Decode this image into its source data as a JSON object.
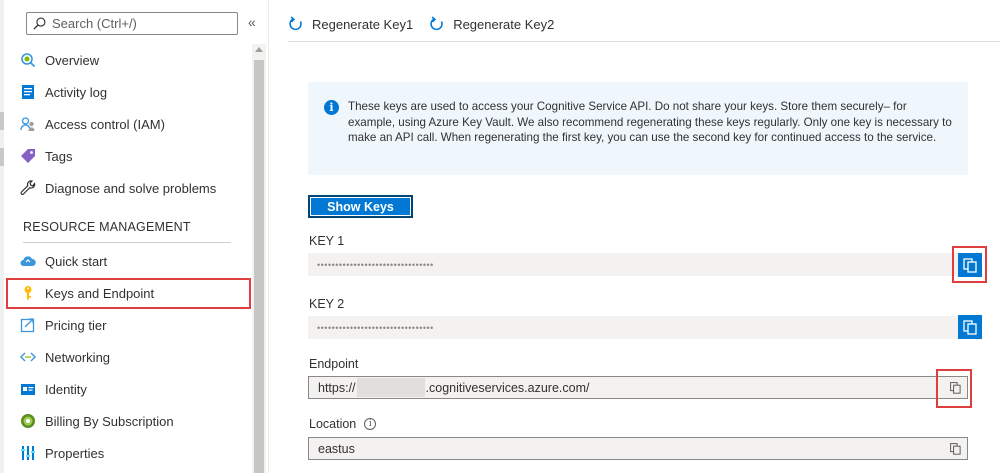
{
  "sidebar": {
    "search_placeholder": "Search (Ctrl+/)",
    "collapse_glyph": "«",
    "items": [
      {
        "label": "Overview",
        "icon": "overview-icon"
      },
      {
        "label": "Activity log",
        "icon": "activity-log-icon"
      },
      {
        "label": "Access control (IAM)",
        "icon": "access-control-icon"
      },
      {
        "label": "Tags",
        "icon": "tag-icon"
      },
      {
        "label": "Diagnose and solve problems",
        "icon": "wrench-icon"
      }
    ],
    "section_title": "RESOURCE MANAGEMENT",
    "resource_items": [
      {
        "label": "Quick start",
        "icon": "cloud-icon"
      },
      {
        "label": "Keys and Endpoint",
        "icon": "key-icon"
      },
      {
        "label": "Pricing tier",
        "icon": "pricing-icon"
      },
      {
        "label": "Networking",
        "icon": "networking-icon"
      },
      {
        "label": "Identity",
        "icon": "identity-icon"
      },
      {
        "label": "Billing By Subscription",
        "icon": "billing-icon"
      },
      {
        "label": "Properties",
        "icon": "properties-icon"
      }
    ]
  },
  "toolbar": {
    "regen_key1": "Regenerate Key1",
    "regen_key2": "Regenerate Key2"
  },
  "info": {
    "icon_glyph": "i",
    "text": "These keys are used to access your Cognitive Service API. Do not share your keys. Store them securely– for example, using Azure Key Vault. We also recommend regenerating these keys regularly. Only one key is necessary to make an API call. When regenerating the first key, you can use the second key for continued access to the service."
  },
  "show_keys_label": "Show Keys",
  "key1": {
    "label": "KEY 1",
    "value": "••••••••••••••••••••••••••••••••"
  },
  "key2": {
    "label": "KEY 2",
    "value": "••••••••••••••••••••••••••••••••"
  },
  "endpoint": {
    "label": "Endpoint",
    "prefix": "https://",
    "suffix": ".cognitiveservices.azure.com/"
  },
  "location": {
    "label": "Location",
    "info_glyph": "i",
    "value": "eastus"
  },
  "colors": {
    "accent": "#0078d4",
    "highlight": "#e03e3e"
  }
}
